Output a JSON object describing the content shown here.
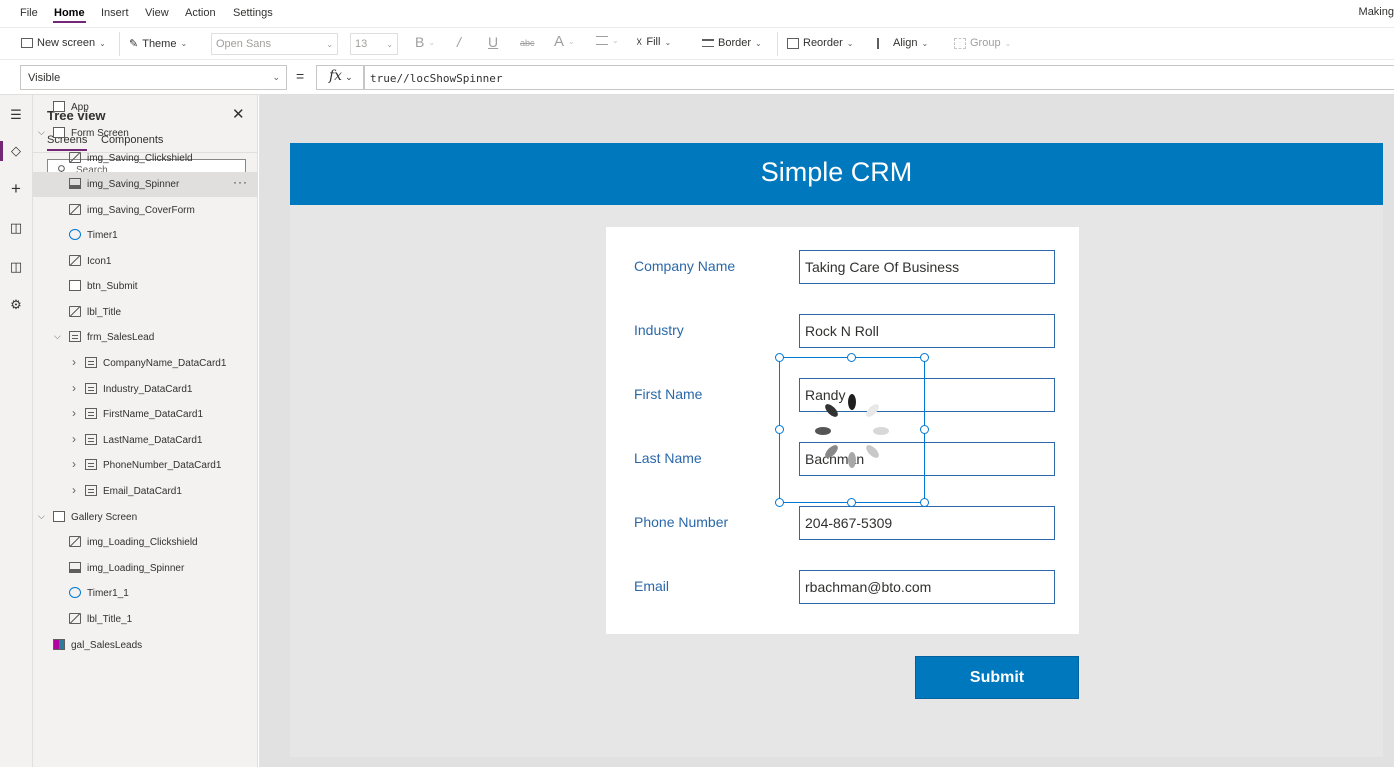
{
  "menu": {
    "file": "File",
    "home": "Home",
    "insert": "Insert",
    "view": "View",
    "action": "Action",
    "settings": "Settings",
    "app_title": "Making"
  },
  "ribbon": {
    "new_screen": "New screen",
    "theme": "Theme",
    "font": "Open Sans",
    "font_size": "13",
    "bold": "B",
    "italic": "/",
    "underline": "U",
    "strike": "abc",
    "font_color": "A",
    "fill": "Fill",
    "border": "Border",
    "reorder": "Reorder",
    "align": "Align",
    "group": "Group"
  },
  "formula_bar": {
    "property": "Visible",
    "equals": "=",
    "fx": "fx",
    "formula": "true//locShowSpinner"
  },
  "tree_view": {
    "title": "Tree view",
    "tabs": [
      "Screens",
      "Components"
    ],
    "search_placeholder": "Search",
    "items": [
      {
        "label": "App",
        "icon": "app-icon"
      },
      {
        "label": "Form Screen",
        "icon": "screen-icon"
      },
      {
        "label": "img_Saving_Clickshield",
        "icon": "image-icon"
      },
      {
        "label": "img_Saving_Spinner",
        "icon": "picture-icon"
      },
      {
        "label": "img_Saving_CoverForm",
        "icon": "image-icon"
      },
      {
        "label": "Timer1",
        "icon": "timer-icon"
      },
      {
        "label": "Icon1",
        "icon": "icon-control-icon"
      },
      {
        "label": "btn_Submit",
        "icon": "button-icon"
      },
      {
        "label": "lbl_Title",
        "icon": "label-icon"
      },
      {
        "label": "frm_SalesLead",
        "icon": "form-icon"
      },
      {
        "label": "CompanyName_DataCard1",
        "icon": "card-icon"
      },
      {
        "label": "Industry_DataCard1",
        "icon": "card-icon"
      },
      {
        "label": "FirstName_DataCard1",
        "icon": "card-icon"
      },
      {
        "label": "LastName_DataCard1",
        "icon": "card-icon"
      },
      {
        "label": "PhoneNumber_DataCard1",
        "icon": "card-icon"
      },
      {
        "label": "Email_DataCard1",
        "icon": "card-icon"
      },
      {
        "label": "Gallery Screen",
        "icon": "screen-icon"
      },
      {
        "label": "img_Loading_Clickshield",
        "icon": "image-icon"
      },
      {
        "label": "img_Loading_Spinner",
        "icon": "picture-icon"
      },
      {
        "label": "Timer1_1",
        "icon": "timer-icon"
      },
      {
        "label": "lbl_Title_1",
        "icon": "label-icon"
      },
      {
        "label": "gal_SalesLeads",
        "icon": "gallery-icon"
      }
    ],
    "selected_more": "···"
  },
  "app": {
    "title": "Simple CRM",
    "fields": [
      {
        "label": "Company Name",
        "value": "Taking Care Of Business"
      },
      {
        "label": "Industry",
        "value": "Rock N Roll"
      },
      {
        "label": "First Name",
        "value": "Randy"
      },
      {
        "label": "Last Name",
        "value": "Bachman"
      },
      {
        "label": "Phone Number",
        "value": "204-867-5309"
      },
      {
        "label": "Email",
        "value": "rbachman@bto.com"
      }
    ],
    "submit": "Submit"
  },
  "colors": {
    "header": "#0078be",
    "accent": "#742774",
    "label": "#2a68a8"
  }
}
